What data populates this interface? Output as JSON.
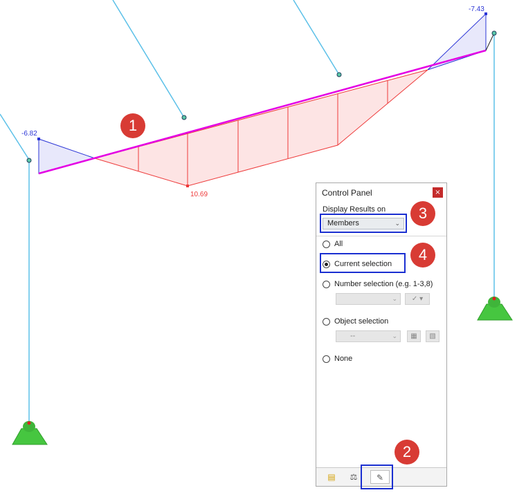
{
  "model_labels": {
    "left_top_value": "-6.82",
    "right_top_value": "-7.43",
    "bottom_value": "10.69"
  },
  "panel": {
    "title": "Control Panel",
    "close_label": "×",
    "group_label": "Display Results on",
    "dropdown_value": "Members",
    "options": {
      "all": "All",
      "current_selection": "Current selection",
      "number_selection": "Number selection (e.g. 1-3,8)",
      "object_selection": "Object selection",
      "none": "None"
    },
    "object_combo_value": "--",
    "selected_option": "current_selection"
  },
  "markers": {
    "m1": "1",
    "m2": "2",
    "m3": "3",
    "m4": "4"
  },
  "colors": {
    "member": "#5bc0e8",
    "beam": "#e400e4",
    "negative_fill": "#e8e8fb",
    "positive_fill": "#fde4e4",
    "highlight": "#1a2fd1",
    "marker": "#d83b34"
  }
}
